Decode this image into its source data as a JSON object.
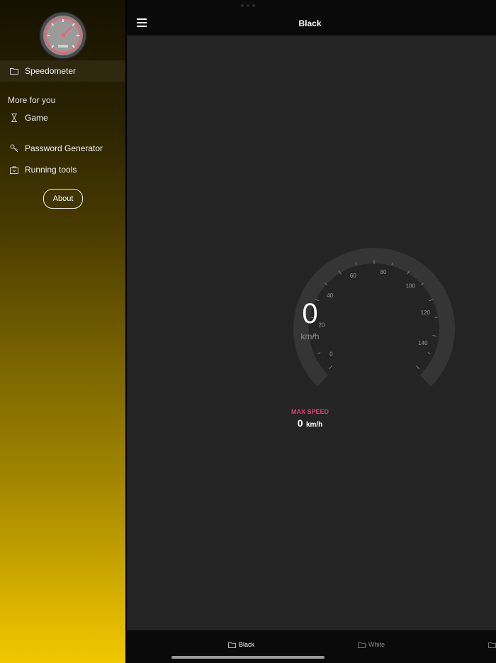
{
  "sidebar": {
    "items": [
      {
        "label": "Speedometer",
        "icon": "folder-icon"
      },
      {
        "label": "Game",
        "icon": "hourglass-icon"
      },
      {
        "label": "Password Generator",
        "icon": "key-icon"
      },
      {
        "label": "Running tools",
        "icon": "toolbox-icon"
      }
    ],
    "section_label": "More for you",
    "about_label": "About"
  },
  "header": {
    "title": "Black",
    "menu_icon": "hamburger-icon"
  },
  "gauge": {
    "speed": "0",
    "unit": "km/h",
    "tick_labels": [
      "0",
      "20",
      "40",
      "60",
      "80",
      "100",
      "120",
      "140"
    ],
    "max_label": "MAX SPEED",
    "max_value": "0",
    "max_unit": "km/h"
  },
  "tabs": [
    {
      "label": "Black",
      "icon": "folder-icon"
    },
    {
      "label": "White",
      "icon": "folder-icon"
    }
  ],
  "colors": {
    "accent": "#e8397a",
    "main_bg": "#242424",
    "bar_bg": "#0a0a0a"
  }
}
